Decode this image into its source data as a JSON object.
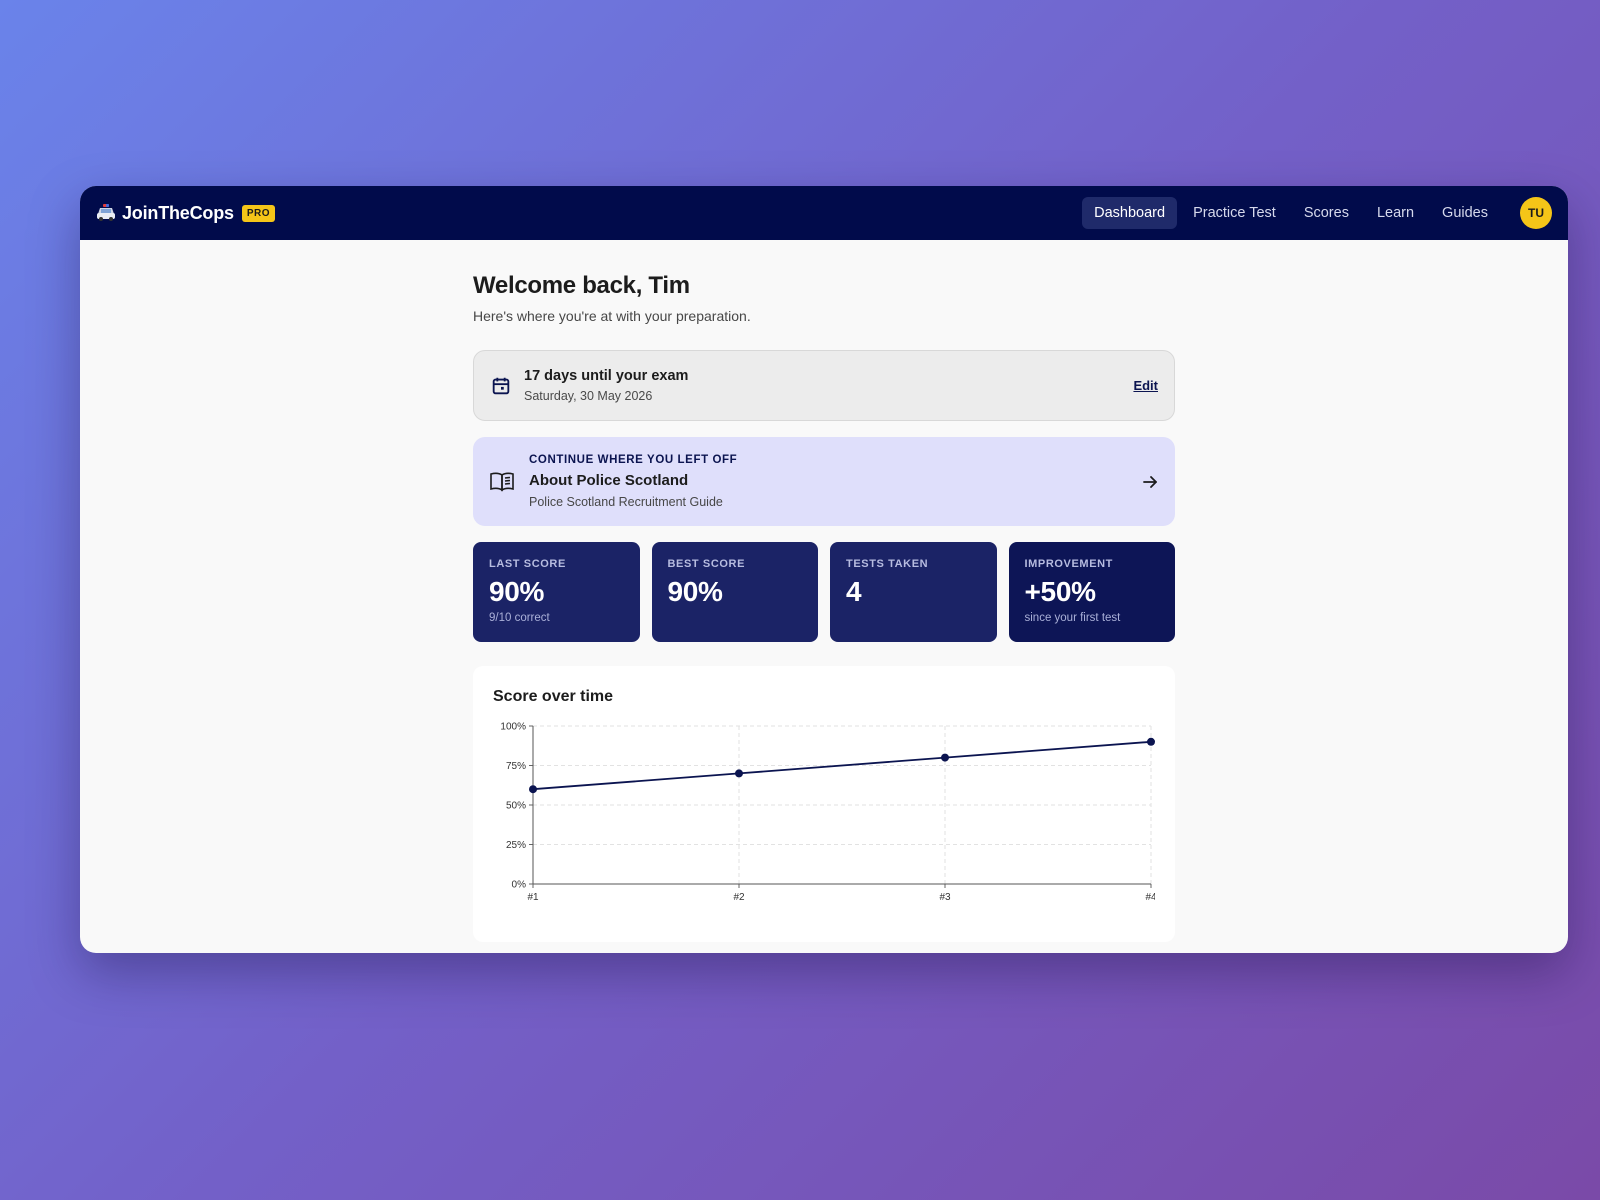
{
  "app": {
    "brand": "JoinTheCops",
    "badge": "PRO",
    "nav": [
      {
        "label": "Dashboard",
        "active": true
      },
      {
        "label": "Practice Test",
        "active": false
      },
      {
        "label": "Scores",
        "active": false
      },
      {
        "label": "Learn",
        "active": false
      },
      {
        "label": "Guides",
        "active": false
      }
    ],
    "avatar_initials": "TU"
  },
  "header": {
    "title": "Welcome back, Tim",
    "subtitle": "Here's where you're at with your preparation."
  },
  "exam": {
    "title": "17 days until your exam",
    "date": "Saturday, 30 May 2026",
    "edit_label": "Edit"
  },
  "continue": {
    "eyebrow": "CONTINUE WHERE YOU LEFT OFF",
    "title": "About Police Scotland",
    "subtitle": "Police Scotland Recruitment Guide"
  },
  "stats": [
    {
      "label": "LAST SCORE",
      "value": "90%",
      "sub": "9/10 correct"
    },
    {
      "label": "BEST SCORE",
      "value": "90%",
      "sub": ""
    },
    {
      "label": "TESTS TAKEN",
      "value": "4",
      "sub": ""
    },
    {
      "label": "IMPROVEMENT",
      "value": "+50%",
      "sub": "since your first test"
    }
  ],
  "colors": {
    "navbar": "#010b4b",
    "accent_yellow": "#f5c518",
    "stat_card": "#1b2366",
    "continue_bg": "#dfdffb",
    "line": "#0b1450"
  },
  "icons": {
    "brand": "police-car-icon",
    "exam": "calendar-icon",
    "continue": "book-open-icon",
    "go": "arrow-right-icon"
  },
  "chart_title": "Score over time",
  "chart_data": {
    "type": "line",
    "title": "Score over time",
    "categories": [
      "#1",
      "#2",
      "#3",
      "#4"
    ],
    "series": [
      {
        "values": [
          60,
          70,
          80,
          90
        ]
      }
    ],
    "y_ticks": [
      "0%",
      "25%",
      "50%",
      "75%",
      "100%"
    ],
    "ylim": [
      0,
      100
    ],
    "grid": true
  }
}
